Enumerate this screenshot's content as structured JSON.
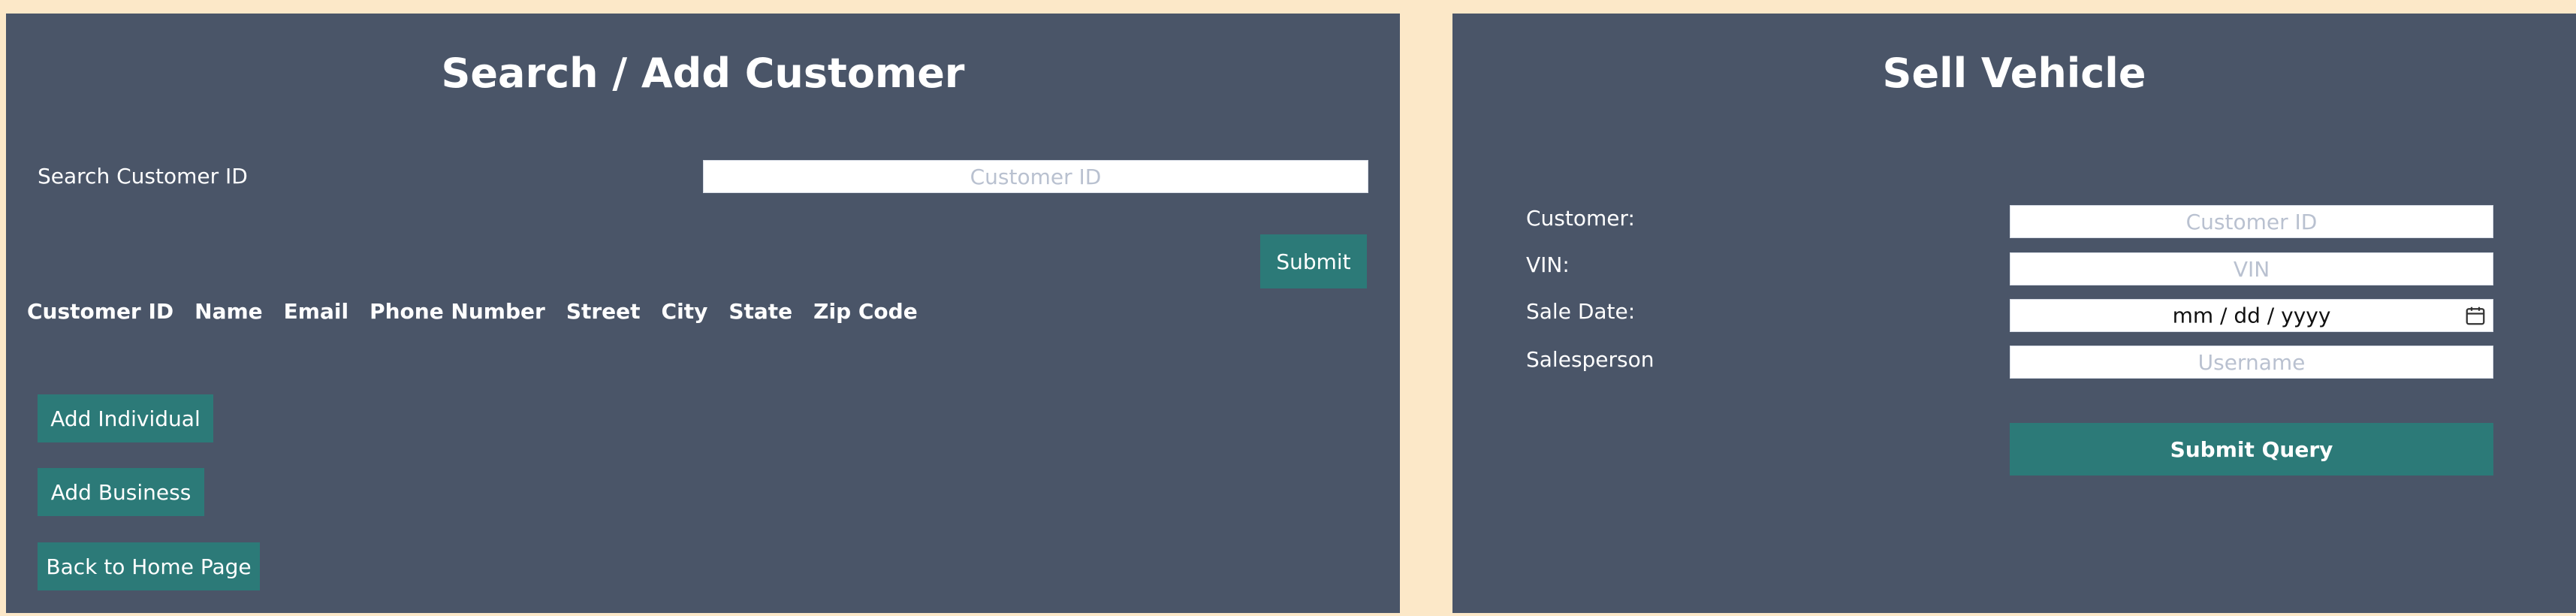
{
  "search_panel": {
    "title": "Search / Add Customer",
    "search_label": "Search Customer ID",
    "search_placeholder": "Customer ID",
    "submit_label": "Submit",
    "columns": [
      "Customer ID",
      "Name",
      "Email",
      "Phone Number",
      "Street",
      "City",
      "State",
      "Zip Code"
    ],
    "add_individual_label": "Add Individual",
    "add_business_label": "Add Business",
    "back_home_label": "Back to Home Page"
  },
  "sell_panel": {
    "title": "Sell Vehicle",
    "customer_label": "Customer:",
    "customer_placeholder": "Customer ID",
    "vin_label": "VIN:",
    "vin_placeholder": "VIN",
    "sale_date_label": "Sale Date:",
    "sale_date_value": "mm / dd / yyyy",
    "salesperson_label": "Salesperson",
    "salesperson_placeholder": "Username",
    "submit_label": "Submit Query"
  },
  "colors": {
    "page_background": "#FCE8C8",
    "panel_background": "#4A5568",
    "accent": "#2C7A78"
  },
  "icons": {
    "calendar": "calendar-icon"
  }
}
